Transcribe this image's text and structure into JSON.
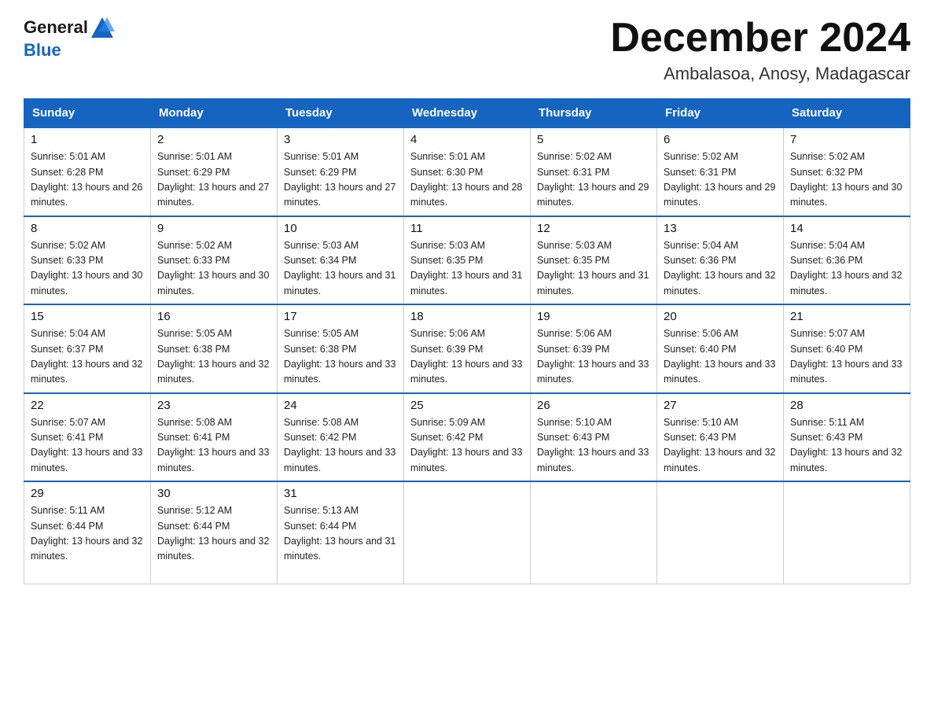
{
  "header": {
    "logo_general": "General",
    "logo_blue": "Blue",
    "title": "December 2024",
    "location": "Ambalasoa, Anosy, Madagascar"
  },
  "days_of_week": [
    "Sunday",
    "Monday",
    "Tuesday",
    "Wednesday",
    "Thursday",
    "Friday",
    "Saturday"
  ],
  "weeks": [
    [
      {
        "day": 1,
        "sunrise": "5:01 AM",
        "sunset": "6:28 PM",
        "daylight": "13 hours and 26 minutes."
      },
      {
        "day": 2,
        "sunrise": "5:01 AM",
        "sunset": "6:29 PM",
        "daylight": "13 hours and 27 minutes."
      },
      {
        "day": 3,
        "sunrise": "5:01 AM",
        "sunset": "6:29 PM",
        "daylight": "13 hours and 27 minutes."
      },
      {
        "day": 4,
        "sunrise": "5:01 AM",
        "sunset": "6:30 PM",
        "daylight": "13 hours and 28 minutes."
      },
      {
        "day": 5,
        "sunrise": "5:02 AM",
        "sunset": "6:31 PM",
        "daylight": "13 hours and 29 minutes."
      },
      {
        "day": 6,
        "sunrise": "5:02 AM",
        "sunset": "6:31 PM",
        "daylight": "13 hours and 29 minutes."
      },
      {
        "day": 7,
        "sunrise": "5:02 AM",
        "sunset": "6:32 PM",
        "daylight": "13 hours and 30 minutes."
      }
    ],
    [
      {
        "day": 8,
        "sunrise": "5:02 AM",
        "sunset": "6:33 PM",
        "daylight": "13 hours and 30 minutes."
      },
      {
        "day": 9,
        "sunrise": "5:02 AM",
        "sunset": "6:33 PM",
        "daylight": "13 hours and 30 minutes."
      },
      {
        "day": 10,
        "sunrise": "5:03 AM",
        "sunset": "6:34 PM",
        "daylight": "13 hours and 31 minutes."
      },
      {
        "day": 11,
        "sunrise": "5:03 AM",
        "sunset": "6:35 PM",
        "daylight": "13 hours and 31 minutes."
      },
      {
        "day": 12,
        "sunrise": "5:03 AM",
        "sunset": "6:35 PM",
        "daylight": "13 hours and 31 minutes."
      },
      {
        "day": 13,
        "sunrise": "5:04 AM",
        "sunset": "6:36 PM",
        "daylight": "13 hours and 32 minutes."
      },
      {
        "day": 14,
        "sunrise": "5:04 AM",
        "sunset": "6:36 PM",
        "daylight": "13 hours and 32 minutes."
      }
    ],
    [
      {
        "day": 15,
        "sunrise": "5:04 AM",
        "sunset": "6:37 PM",
        "daylight": "13 hours and 32 minutes."
      },
      {
        "day": 16,
        "sunrise": "5:05 AM",
        "sunset": "6:38 PM",
        "daylight": "13 hours and 32 minutes."
      },
      {
        "day": 17,
        "sunrise": "5:05 AM",
        "sunset": "6:38 PM",
        "daylight": "13 hours and 33 minutes."
      },
      {
        "day": 18,
        "sunrise": "5:06 AM",
        "sunset": "6:39 PM",
        "daylight": "13 hours and 33 minutes."
      },
      {
        "day": 19,
        "sunrise": "5:06 AM",
        "sunset": "6:39 PM",
        "daylight": "13 hours and 33 minutes."
      },
      {
        "day": 20,
        "sunrise": "5:06 AM",
        "sunset": "6:40 PM",
        "daylight": "13 hours and 33 minutes."
      },
      {
        "day": 21,
        "sunrise": "5:07 AM",
        "sunset": "6:40 PM",
        "daylight": "13 hours and 33 minutes."
      }
    ],
    [
      {
        "day": 22,
        "sunrise": "5:07 AM",
        "sunset": "6:41 PM",
        "daylight": "13 hours and 33 minutes."
      },
      {
        "day": 23,
        "sunrise": "5:08 AM",
        "sunset": "6:41 PM",
        "daylight": "13 hours and 33 minutes."
      },
      {
        "day": 24,
        "sunrise": "5:08 AM",
        "sunset": "6:42 PM",
        "daylight": "13 hours and 33 minutes."
      },
      {
        "day": 25,
        "sunrise": "5:09 AM",
        "sunset": "6:42 PM",
        "daylight": "13 hours and 33 minutes."
      },
      {
        "day": 26,
        "sunrise": "5:10 AM",
        "sunset": "6:43 PM",
        "daylight": "13 hours and 33 minutes."
      },
      {
        "day": 27,
        "sunrise": "5:10 AM",
        "sunset": "6:43 PM",
        "daylight": "13 hours and 32 minutes."
      },
      {
        "day": 28,
        "sunrise": "5:11 AM",
        "sunset": "6:43 PM",
        "daylight": "13 hours and 32 minutes."
      }
    ],
    [
      {
        "day": 29,
        "sunrise": "5:11 AM",
        "sunset": "6:44 PM",
        "daylight": "13 hours and 32 minutes."
      },
      {
        "day": 30,
        "sunrise": "5:12 AM",
        "sunset": "6:44 PM",
        "daylight": "13 hours and 32 minutes."
      },
      {
        "day": 31,
        "sunrise": "5:13 AM",
        "sunset": "6:44 PM",
        "daylight": "13 hours and 31 minutes."
      },
      null,
      null,
      null,
      null
    ]
  ]
}
